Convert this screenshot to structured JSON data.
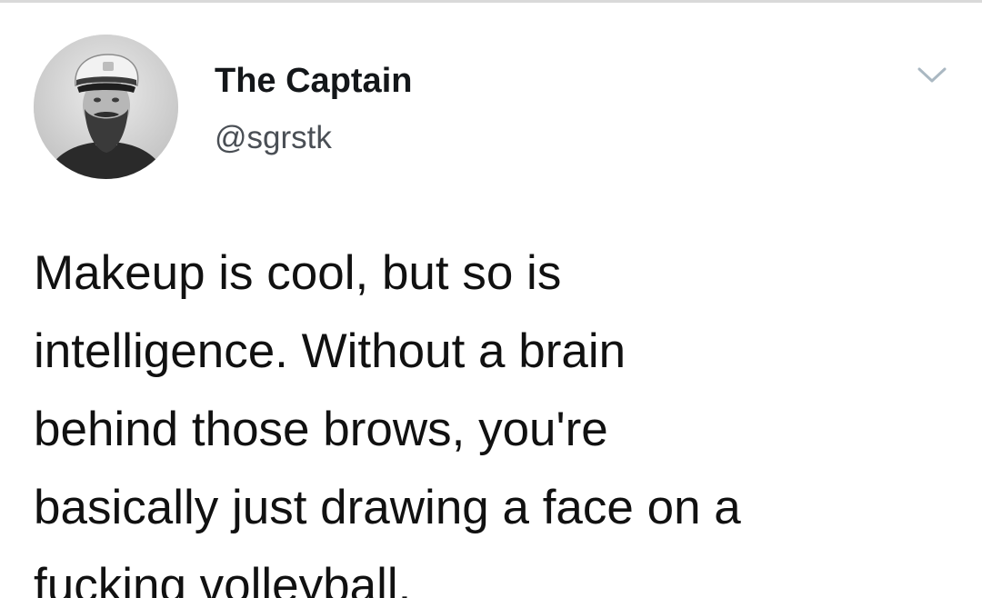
{
  "author": {
    "display_name": "The Captain",
    "handle": "@sgrstk",
    "avatar": "profile-photo-captain-hat"
  },
  "menu": {
    "icon": "chevron-down-icon",
    "color": "#aab8c2"
  },
  "tweet": {
    "lines": [
      "Makeup is cool, but so is",
      "intelligence. Without a brain",
      "behind those brows, you're",
      "basically just drawing a face on a",
      "fucking volleyball."
    ]
  }
}
